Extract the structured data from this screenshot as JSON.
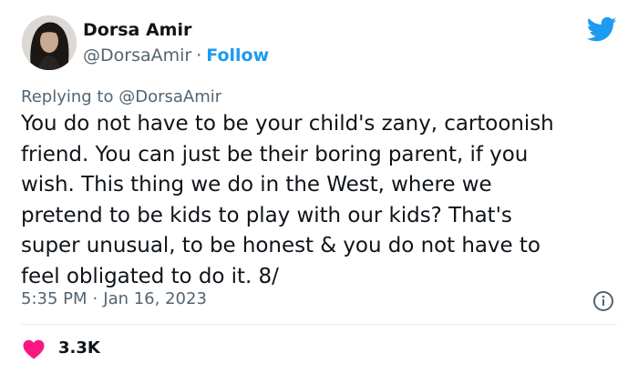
{
  "author": {
    "display_name": "Dorsa Amir",
    "handle": "@DorsaAmir",
    "separator": "·",
    "follow_label": "Follow"
  },
  "reply": {
    "prefix": "Replying to",
    "to_handle": "@DorsaAmir"
  },
  "tweet": {
    "text": "You do not have to be your child's zany, cartoonish\nfriend. You can just be their boring parent, if you\nwish. This thing we do in the West, where we\npretend to be kids to play with our kids? That's\nsuper unusual, to be honest & you do not have to\nfeel obligated to do it. 8/",
    "time": "5:35 PM",
    "separator": "·",
    "date": "Jan 16, 2023"
  },
  "stats": {
    "likes": "3.3K"
  },
  "icons": {
    "platform": "twitter-bird-icon",
    "info": "info-icon",
    "like": "heart-icon"
  },
  "colors": {
    "accent": "#1d9bf0",
    "like": "#f91880",
    "secondary_text": "#536471"
  }
}
